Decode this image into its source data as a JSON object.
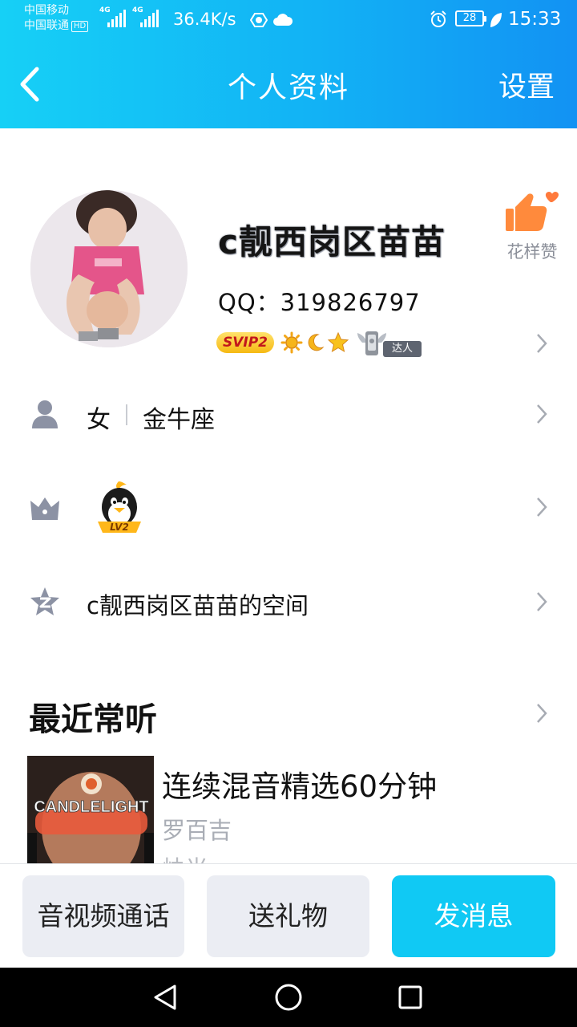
{
  "status_bar": {
    "carrier_1": "中国移动",
    "carrier_2": "中国联通",
    "hd_tag": "HD",
    "net_tag": "4G",
    "net_speed": "36.4K/s",
    "battery": "28",
    "time": "15:33",
    "icons": [
      "signal-icon",
      "signal-icon",
      "vpn-icon",
      "cloud-icon",
      "alarm-icon",
      "battery-icon",
      "eco-leaf-icon"
    ]
  },
  "nav": {
    "back_icon": "chevron-left-icon",
    "title": "个人资料",
    "settings": "设置"
  },
  "profile": {
    "nickname": "c靓西岗区苗苗",
    "qq_line": "QQ：319826797",
    "svip": "SVIP2",
    "level_icons": [
      "sun-icon",
      "moon-icon",
      "star-icon"
    ],
    "daren_label": "达人",
    "like_label": "花样赞"
  },
  "info_rows": {
    "gender": "女",
    "zodiac": "金牛座",
    "qq_level": "LV2",
    "space": "c靓西岗区苗苗的空间"
  },
  "recent": {
    "section_title": "最近常听",
    "album_text": "CANDLELIGHT",
    "song_title": "连续混音精选60分钟",
    "artist": "罗百吉",
    "extra": "烛光"
  },
  "actions": {
    "call": "音视频通话",
    "gift": "送礼物",
    "message": "发消息"
  },
  "colors": {
    "header_start": "#16d0f6",
    "header_end": "#1292f3",
    "primary_button": "#10c9f4",
    "secondary_button": "#ebedf3",
    "muted_text": "#a9adb5"
  }
}
